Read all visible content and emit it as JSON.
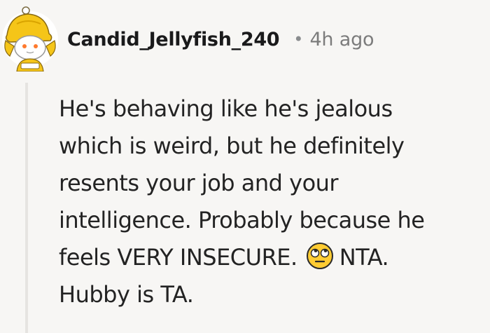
{
  "comment": {
    "author": "Candid_Jellyfish_240",
    "separator": "•",
    "time_ago": "4h ago",
    "avatar_icon": "snoo-avatar-yellow-hat",
    "body_lines": [
      "He's behaving like he's jealous",
      "which is weird, but he definitely",
      "resents your job and your",
      "intelligence. Probably because he"
    ],
    "body_line5_before_emoji": "feels VERY INSECURE.",
    "emoji_icon": "face-with-rolling-eyes-emoji",
    "body_line5_after_emoji": "NTA.",
    "body_line6": "Hubby is TA."
  },
  "colors": {
    "background": "#f7f6f4",
    "username": "#1a1a1b",
    "meta": "#7c7c7c",
    "thread_line": "#e6e4e1",
    "avatar_hat": "#f5c518"
  }
}
